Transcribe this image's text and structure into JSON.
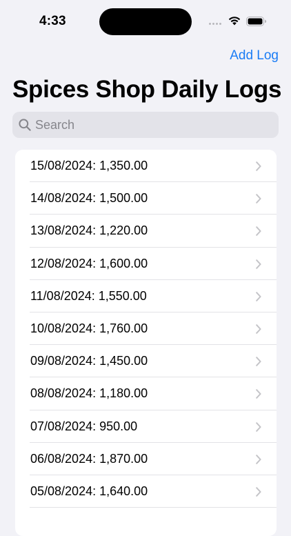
{
  "status_bar": {
    "time": "4:33",
    "icons": [
      "signal-dots-icon",
      "wifi-icon",
      "battery-icon"
    ]
  },
  "nav": {
    "add_log_label": "Add Log",
    "title": "Spices Shop Daily Logs"
  },
  "search": {
    "placeholder": "Search",
    "value": ""
  },
  "logs": [
    {
      "text": "15/08/2024: 1,350.00"
    },
    {
      "text": "14/08/2024: 1,500.00"
    },
    {
      "text": "13/08/2024: 1,220.00"
    },
    {
      "text": "12/08/2024: 1,600.00"
    },
    {
      "text": "11/08/2024: 1,550.00"
    },
    {
      "text": "10/08/2024: 1,760.00"
    },
    {
      "text": "09/08/2024: 1,450.00"
    },
    {
      "text": "08/08/2024: 1,180.00"
    },
    {
      "text": "07/08/2024: 950.00"
    },
    {
      "text": "06/08/2024: 1,870.00"
    },
    {
      "text": "05/08/2024: 1,640.00"
    },
    {
      "text": ""
    }
  ],
  "colors": {
    "accent": "#1a7cf5",
    "background": "#f2f2f7",
    "search_field": "#e3e3e9",
    "chevron": "#c4c4c8"
  }
}
